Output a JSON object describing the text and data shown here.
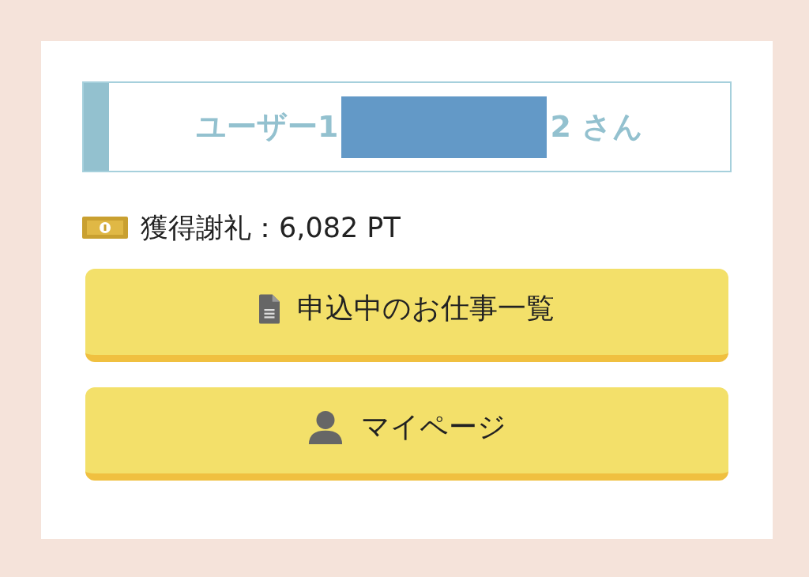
{
  "user_header": {
    "name_start": "ユーザー1",
    "name_end": "2 さん"
  },
  "reward": {
    "label": "獲得謝礼：6,082 PT"
  },
  "buttons": [
    {
      "kind": "document",
      "label": "申込中のお仕事一覧"
    },
    {
      "kind": "person",
      "label": "マイページ"
    }
  ]
}
